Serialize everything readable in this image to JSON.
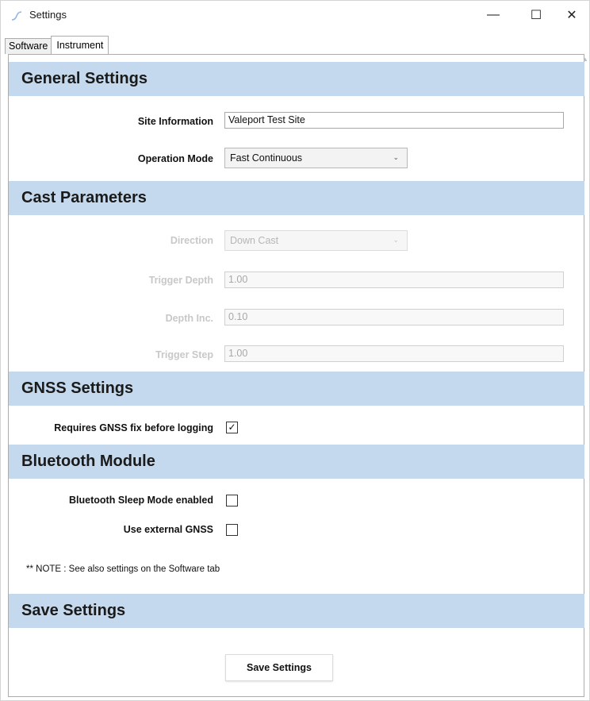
{
  "window": {
    "title": "Settings",
    "icon": "app-wave-icon",
    "controls": {
      "minimize": "—",
      "maximize": "☐",
      "close": "✕"
    }
  },
  "tabs": [
    {
      "label": "Software",
      "active": false
    },
    {
      "label": "Instrument",
      "active": true
    }
  ],
  "general_settings": {
    "title": "General Settings",
    "site_information": {
      "label": "Site Information",
      "value": "Valeport Test Site"
    },
    "operation_mode": {
      "label": "Operation Mode",
      "value": "Fast Continuous",
      "arrow": "⌄"
    }
  },
  "cast_parameters": {
    "title": "Cast Parameters",
    "direction": {
      "label": "Direction",
      "value": "Down Cast",
      "arrow": "⌄",
      "enabled": false
    },
    "trigger_depth": {
      "label": "Trigger Depth",
      "value": "1.00",
      "enabled": false
    },
    "depth_inc": {
      "label": "Depth Inc.",
      "value": "0.10",
      "enabled": false
    },
    "trigger_step": {
      "label": "Trigger Step",
      "value": "1.00",
      "enabled": false
    }
  },
  "gnss_settings": {
    "title": "GNSS Settings",
    "requires_fix": {
      "label": "Requires GNSS fix before logging",
      "checked": true,
      "mark": "✓"
    }
  },
  "bluetooth_module": {
    "title": "Bluetooth Module",
    "sleep_mode": {
      "label": "Bluetooth Sleep Mode enabled",
      "checked": false
    },
    "external_gnss": {
      "label": "Use external GNSS",
      "checked": false
    }
  },
  "note": "** NOTE : See also settings on the Software tab",
  "save_settings": {
    "title": "Save Settings",
    "button_label": "Save Settings"
  },
  "colors": {
    "section_header_bg": "#c5d9ee",
    "disabled_text": "#c8c8c8"
  }
}
